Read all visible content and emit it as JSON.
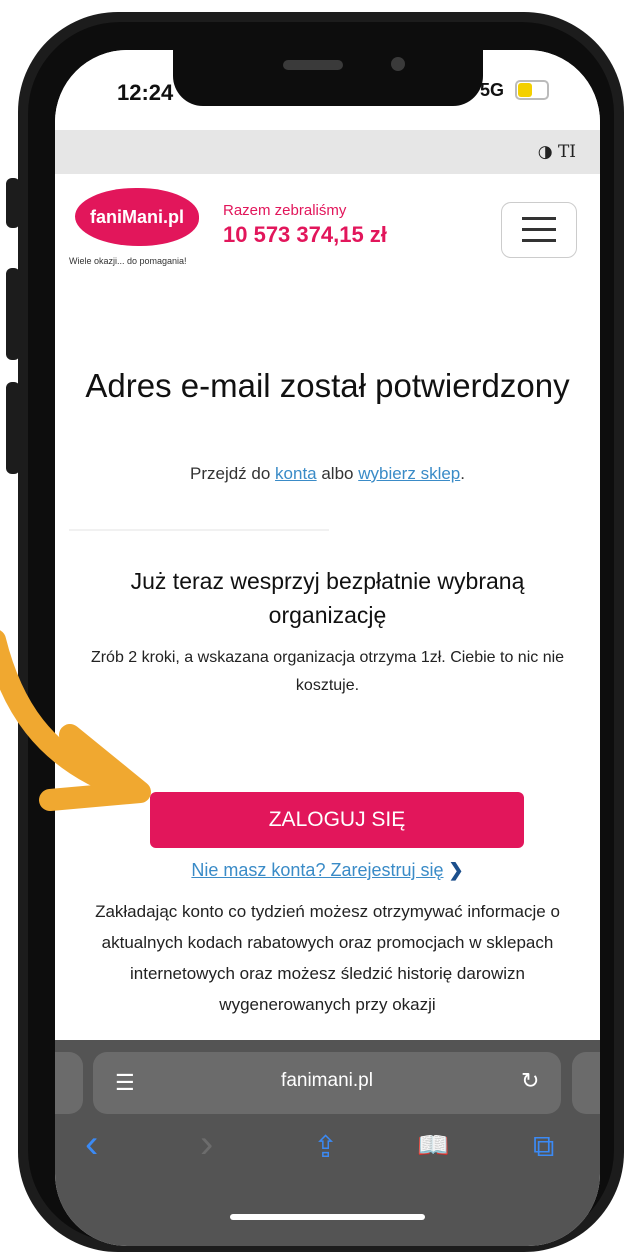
{
  "status_bar": {
    "time": "12:24",
    "network": "5G"
  },
  "reader_bar": {
    "tools": "◑ TI"
  },
  "header": {
    "logo_text": "faniMani.pl",
    "tagline": "Wiele okazji... do pomagania!",
    "raised_label": "Razem zebraliśmy",
    "raised_amount": "10 573 374,15 zł"
  },
  "main": {
    "heading": "Adres e-mail został potwierdzony",
    "sub_prefix": "Przejdź do ",
    "sub_link_account": "konta",
    "sub_middle": " albo ",
    "sub_link_shop": "wybierz sklep",
    "sub_suffix": ".",
    "support_heading": "Już teraz wesprzyj bezpłatnie wybraną organizację",
    "steps_text": "Zrób 2 kroki, a wskazana organizacja otrzyma 1zł. Ciebie to nic nie kosztuje.",
    "login_button": "ZALOGUJ SIĘ",
    "register_link": "Nie masz konta? Zarejestruj się",
    "register_chevron": "❯",
    "info_text": "Zakładając konto co tydzień możesz otrzymywać informacje o aktualnych kodach rabatowych oraz promocjach w sklepach internetowych oraz możesz śledzić historię darowizn wygenerowanych przy okazji"
  },
  "browser": {
    "url": "fanimani.pl",
    "page_icon": "☰",
    "reload_icon": "↻",
    "back_icon": "‹",
    "forward_icon": "›",
    "share_icon": "⇪",
    "bookmarks_icon": "📖",
    "tabs_icon": "⧉"
  },
  "colors": {
    "brand": "#e2165b",
    "link": "#3a8bc7",
    "arrow": "#f0a830",
    "safari_blue": "#3b8af5"
  }
}
